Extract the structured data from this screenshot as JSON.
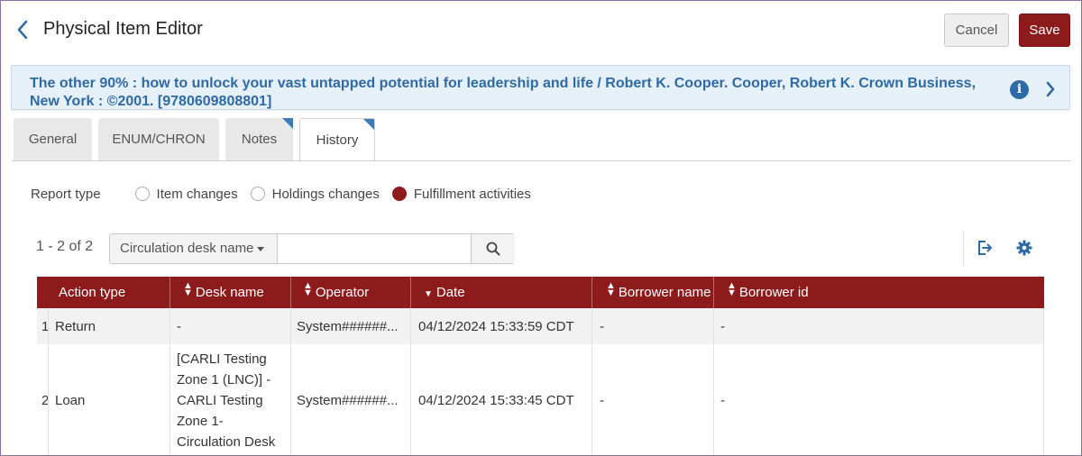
{
  "header": {
    "title": "Physical Item Editor",
    "cancel_label": "Cancel",
    "save_label": "Save"
  },
  "banner": {
    "text": "The other 90% : how to unlock your vast untapped potential for leadership and life / Robert K. Cooper. Cooper, Robert K. Crown Business, New York : ©2001. [9780609808801]"
  },
  "tabs": [
    {
      "label": "General",
      "active": false
    },
    {
      "label": "ENUM/CHRON",
      "active": false
    },
    {
      "label": "Notes",
      "active": false
    },
    {
      "label": "History",
      "active": true
    }
  ],
  "report_type": {
    "label": "Report type",
    "options": [
      {
        "label": "Item changes",
        "checked": false
      },
      {
        "label": "Holdings changes",
        "checked": false
      },
      {
        "label": "Fulfillment activities",
        "checked": true
      }
    ]
  },
  "toolbar": {
    "count": "1 - 2 of 2",
    "search_scope": "Circulation desk name",
    "search_value": ""
  },
  "table": {
    "columns": [
      "Action type",
      "Desk name",
      "Operator",
      "Date",
      "Borrower name",
      "Borrower id"
    ],
    "rows": [
      {
        "num": "1",
        "action_type": "Return",
        "desk_name": "-",
        "operator": "System######...",
        "date": "04/12/2024 15:33:59 CDT",
        "borrower_name": "-",
        "borrower_id": "-"
      },
      {
        "num": "2",
        "action_type": "Loan",
        "desk_name": "[CARLI Testing Zone 1 (LNC)] - CARLI Testing Zone 1- Circulation Desk",
        "operator": "System######...",
        "date": "04/12/2024 15:33:45 CDT",
        "borrower_name": "-",
        "borrower_id": "-"
      }
    ]
  },
  "colors": {
    "accent": "#8e1b1b",
    "link": "#2d6aa6",
    "banner_bg": "#e6f0f8"
  }
}
